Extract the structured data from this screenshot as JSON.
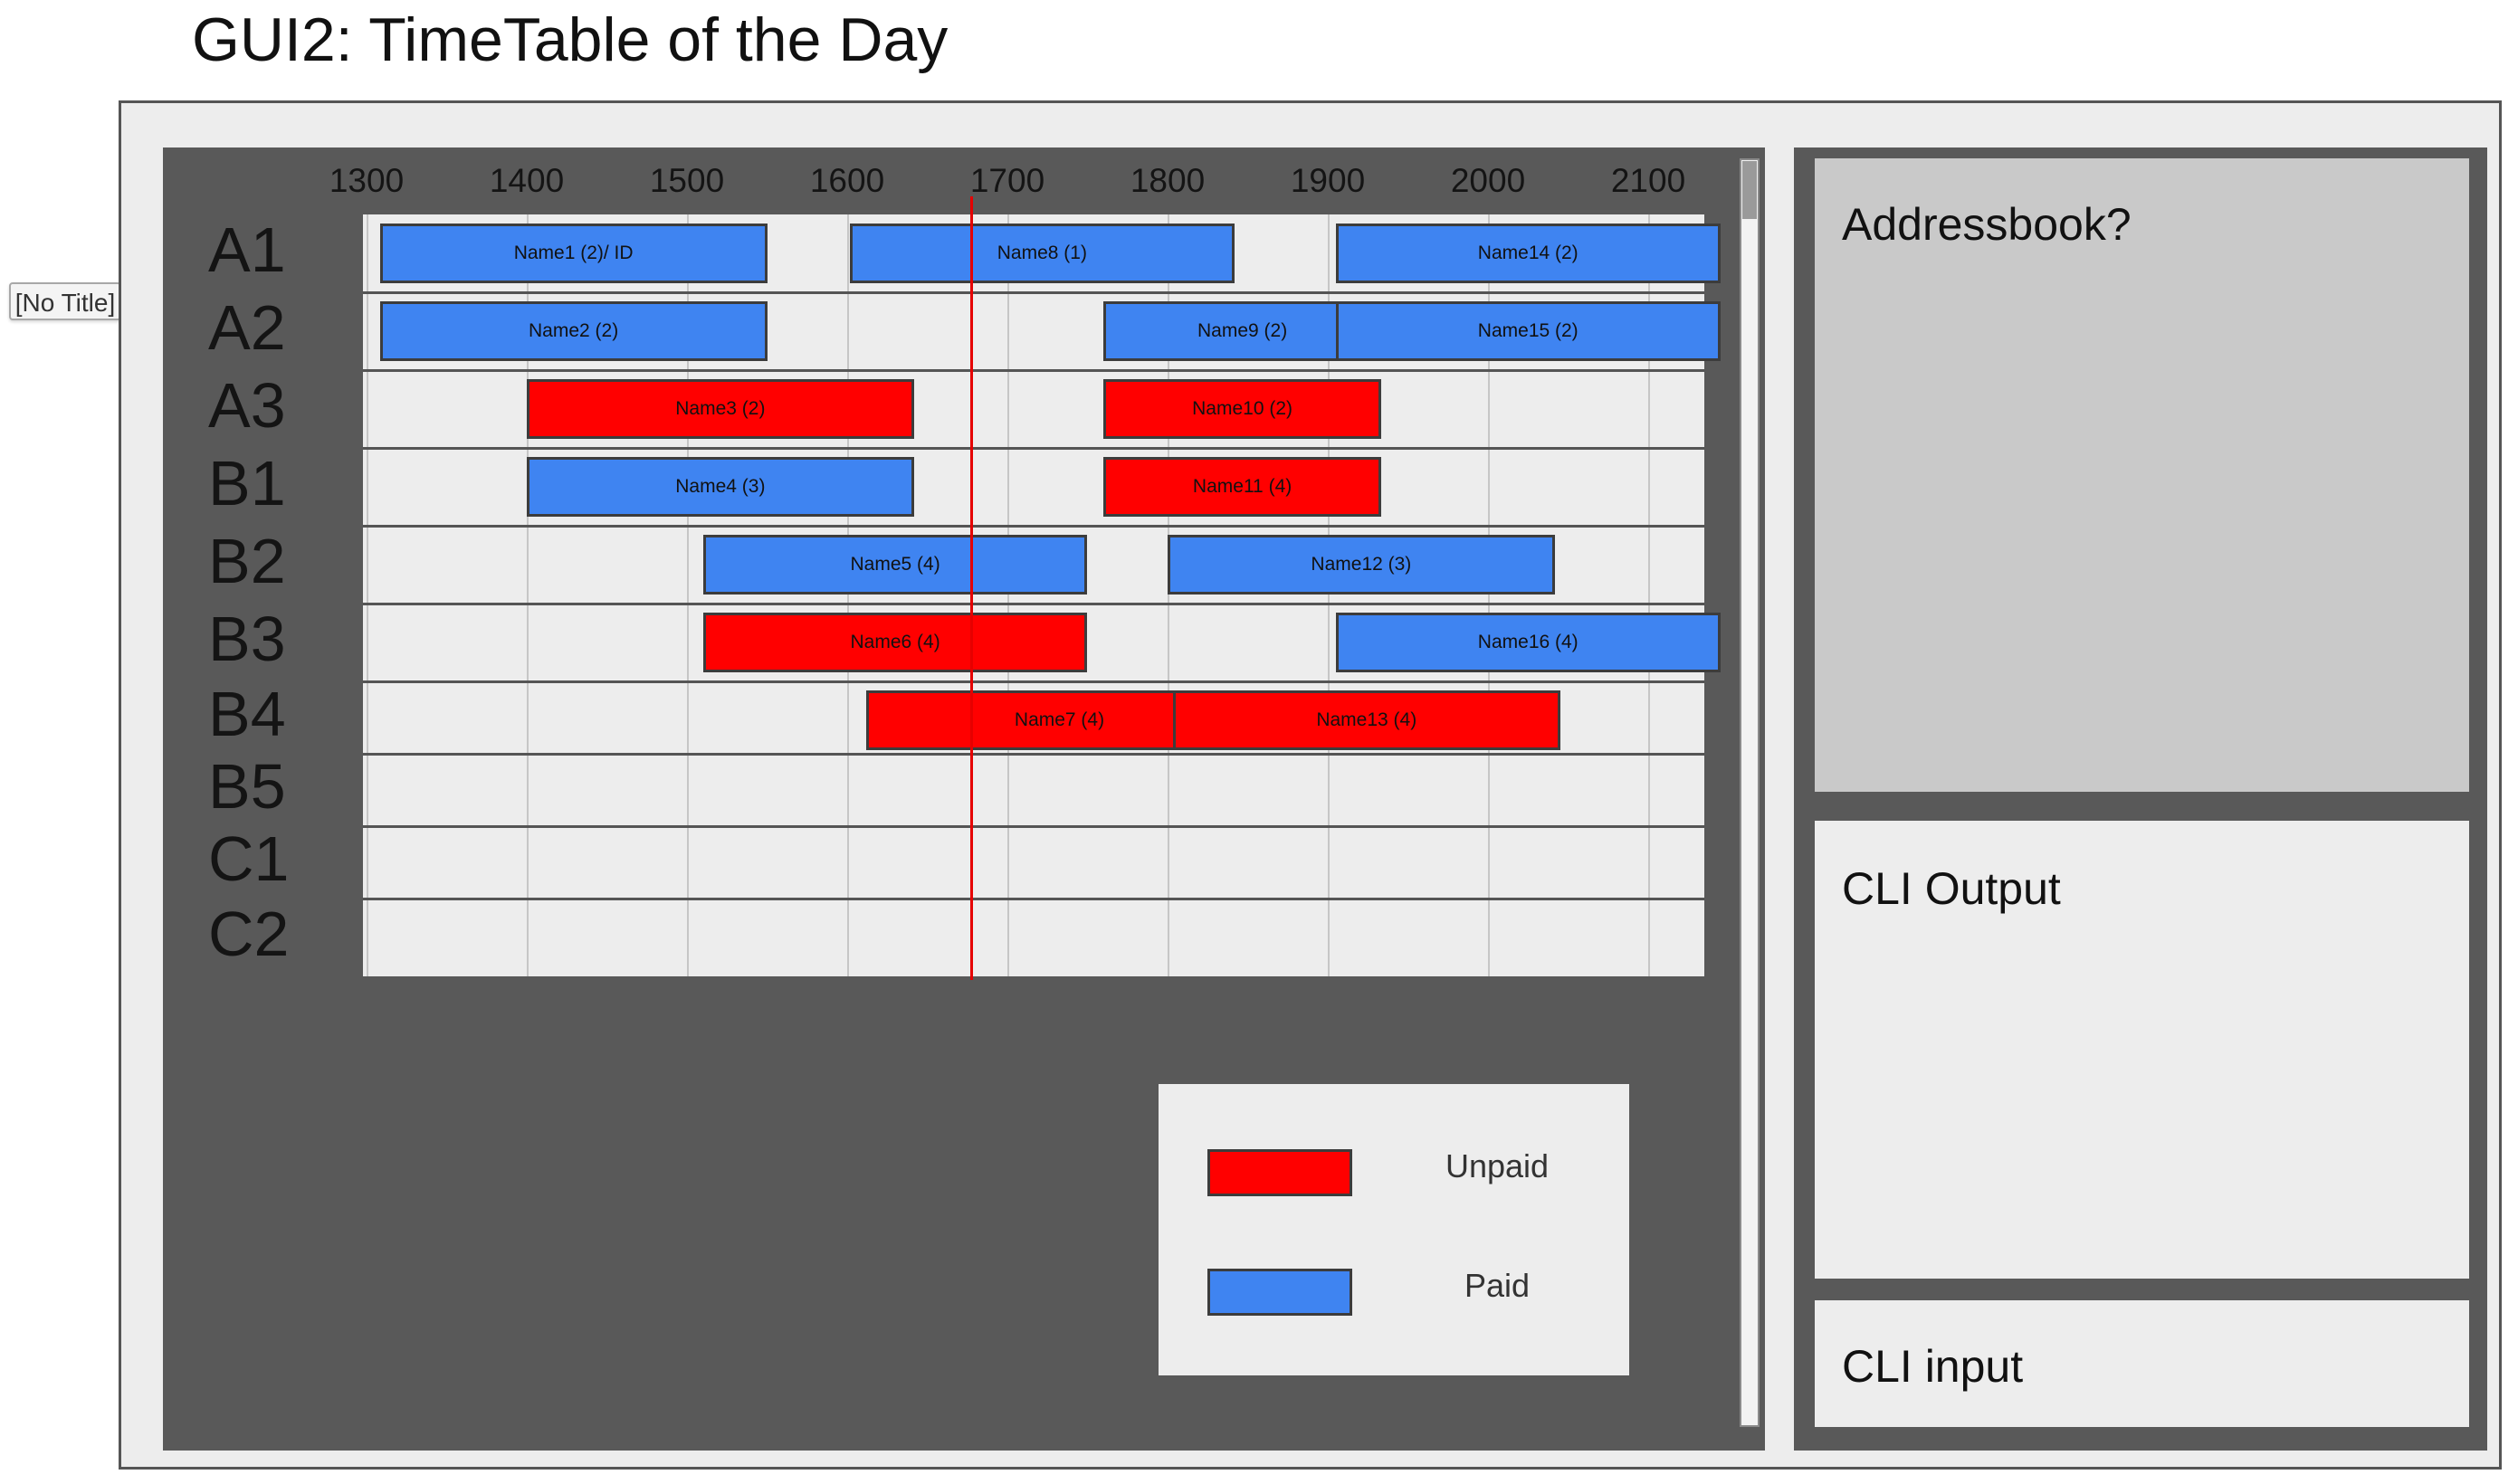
{
  "page": {
    "title": "GUI2: TimeTable of the Day",
    "badge": "[No Title]"
  },
  "timetable": {
    "times": [
      "1300",
      "1400",
      "1500",
      "1600",
      "1700",
      "1800",
      "1900",
      "2000",
      "2100"
    ],
    "rooms": [
      "A1",
      "A2",
      "A3",
      "B1",
      "B2",
      "B3",
      "B4",
      "B5",
      "C1",
      "C2"
    ],
    "current_time": 1646,
    "bookings": [
      {
        "room": "A1",
        "start": 1305,
        "end": 1490,
        "label": "Name1 (2)/ ID",
        "status": "paid"
      },
      {
        "room": "A1",
        "start": 1601,
        "end": 1785,
        "label": "Name8 (1)",
        "status": "paid"
      },
      {
        "room": "A1",
        "start": 1903,
        "end": 2087,
        "label": "Name14 (2)",
        "status": "paid"
      },
      {
        "room": "A2",
        "start": 1305,
        "end": 1490,
        "label": "Name2 (2)",
        "status": "paid"
      },
      {
        "room": "A2",
        "start": 1696,
        "end": 1880,
        "label": "Name9 (2)",
        "status": "paid"
      },
      {
        "room": "A2",
        "start": 1903,
        "end": 2087,
        "label": "Name15 (2)",
        "status": "paid"
      },
      {
        "room": "A3",
        "start": 1400,
        "end": 1585,
        "label": "Name3 (2)",
        "status": "unpaid"
      },
      {
        "room": "A3",
        "start": 1696,
        "end": 1880,
        "label": "Name10 (2)",
        "status": "unpaid"
      },
      {
        "room": "B1",
        "start": 1400,
        "end": 1585,
        "label": "Name4 (3)",
        "status": "paid"
      },
      {
        "room": "B1",
        "start": 1696,
        "end": 1880,
        "label": "Name11 (4)",
        "status": "unpaid"
      },
      {
        "room": "B2",
        "start": 1506,
        "end": 1690,
        "label": "Name5 (4)",
        "status": "paid"
      },
      {
        "room": "B2",
        "start": 1800,
        "end": 1985,
        "label": "Name12 (3)",
        "status": "paid"
      },
      {
        "room": "B3",
        "start": 1506,
        "end": 1690,
        "label": "Name6 (4)",
        "status": "unpaid"
      },
      {
        "room": "B3",
        "start": 1903,
        "end": 2087,
        "label": "Name16 (4)",
        "status": "paid"
      },
      {
        "room": "B4",
        "start": 1607,
        "end": 1792,
        "label": "Name7 (4)",
        "status": "unpaid"
      },
      {
        "room": "B4",
        "start": 1802,
        "end": 1987,
        "label": "Name13 (4)",
        "status": "unpaid"
      }
    ]
  },
  "legend": {
    "items": [
      {
        "label": "Unpaid",
        "color": "#ff0000"
      },
      {
        "label": "Paid",
        "color": "#3f84f1"
      }
    ]
  },
  "sidebar": {
    "addressbook_title": "Addressbook?",
    "cli_output_title": "CLI Output",
    "cli_input_title": "CLI input"
  },
  "colors": {
    "paid": "#3f84f1",
    "unpaid": "#ff0000",
    "panel": "#595959",
    "now_line": "#e60000"
  }
}
